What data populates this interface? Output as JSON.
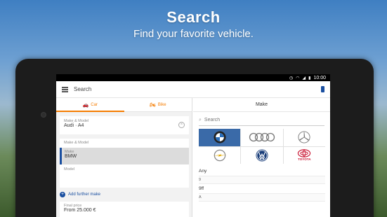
{
  "promo": {
    "title": "Search",
    "subtitle": "Find your favorite vehicle."
  },
  "statusbar": {
    "time": "10:00"
  },
  "toolbar": {
    "title": "Search"
  },
  "tabs": [
    {
      "label": "Car",
      "icon": "car-icon",
      "active": true
    },
    {
      "label": "Bike",
      "icon": "bike-icon",
      "active": false
    }
  ],
  "filters": {
    "make_model_label": "Make & Model",
    "make_model_value": "Audi · A4",
    "make_model_label_2": "Make & Model",
    "make_label": "Make",
    "make_value": "BMW",
    "model_label": "Model",
    "add_make_label": "Add further make",
    "final_price_label": "Final price",
    "final_price_value": "From 25.000 €"
  },
  "make_panel": {
    "title": "Make",
    "search_placeholder": "Search",
    "logos": [
      "BMW",
      "Audi",
      "Mercedes-Benz",
      "Opel",
      "Volkswagen",
      "Toyota"
    ],
    "selected_logo": "BMW",
    "toyota_wordmark": "TOYOTA",
    "list": [
      {
        "text": "Any",
        "section": false
      },
      {
        "text": "9",
        "section": true
      },
      {
        "text": "9ff",
        "section": false
      },
      {
        "text": "A",
        "section": true
      }
    ]
  },
  "colors": {
    "accent": "#f57c00",
    "brand_blue": "#1a4fa0"
  }
}
